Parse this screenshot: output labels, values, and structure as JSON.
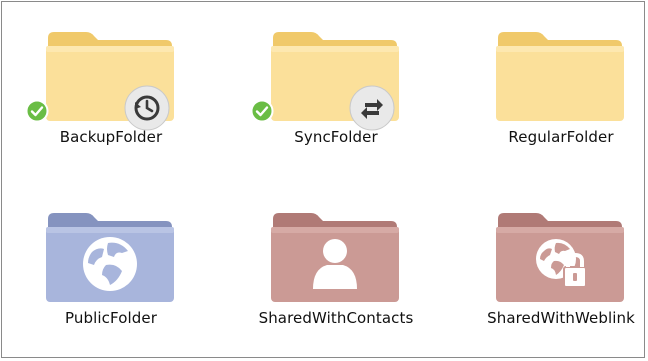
{
  "folders": [
    {
      "label": "BackupFolder",
      "style": "yellow",
      "overlay": "history-icon",
      "synced": true
    },
    {
      "label": "SyncFolder",
      "style": "yellow",
      "overlay": "sync-arrows-icon",
      "synced": true
    },
    {
      "label": "RegularFolder",
      "style": "yellow",
      "overlay": null,
      "synced": false
    },
    {
      "label": "PublicFolder",
      "style": "blue",
      "overlay": "globe-icon",
      "synced": false
    },
    {
      "label": "SharedWithContacts",
      "style": "rose",
      "overlay": "person-icon",
      "synced": false
    },
    {
      "label": "SharedWithWeblink",
      "style": "rose",
      "overlay": "globe-lock-icon",
      "synced": false
    }
  ],
  "colors": {
    "yellow_back": "#f0c96a",
    "yellow_front": "#fbe09a",
    "blue_back": "#8593bf",
    "blue_front": "#a8b5dc",
    "rose_back": "#b07a76",
    "rose_front": "#cb9a95",
    "check_green": "#6abd45"
  }
}
